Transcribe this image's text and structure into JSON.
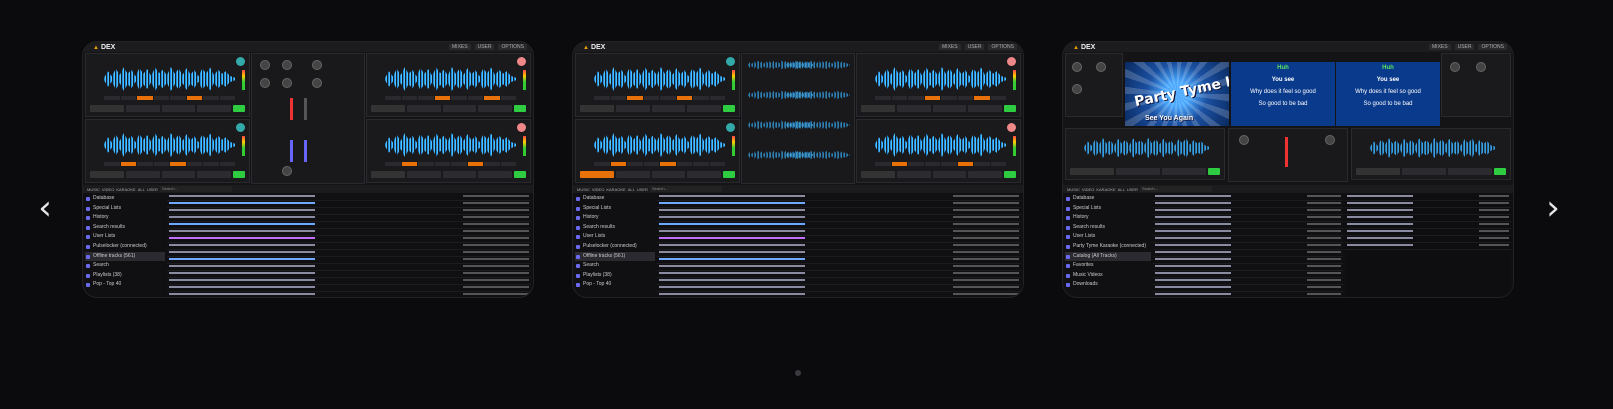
{
  "nav": {
    "prev_icon": "‹",
    "next_icon": "›"
  },
  "app": {
    "logo": "DEX"
  },
  "topbar": [
    "MIXES",
    "USER",
    "OPTIONS"
  ],
  "browser_tools": [
    "MUSIC",
    "VIDEO",
    "KARAOKE",
    "ALL",
    "USER"
  ],
  "search_placeholder": "Search...",
  "slides": [
    {
      "tree": [
        "Database",
        "Special Lists",
        "History",
        "Search results",
        "User Lists",
        "Pulselocker (connected)",
        "Offline tracks (561)",
        "Search",
        "Playlists (38)",
        "Pop - Top 40"
      ],
      "selected": 6
    },
    {
      "tree": [
        "Database",
        "Special Lists",
        "History",
        "Search results",
        "User Lists",
        "Pulselocker (connected)",
        "Offline tracks (561)",
        "Search",
        "Playlists (38)",
        "Pop - Top 40"
      ],
      "selected": 6
    },
    {
      "tree": [
        "Database",
        "Special Lists",
        "History",
        "Search results",
        "User Lists",
        "Party Tyme Karaoke (connected)",
        "Catalog (All Tracks)",
        "Favorites",
        "Music Videos",
        "Downloads"
      ],
      "selected": 6
    }
  ],
  "karaoke": {
    "video_title": "Party Tyme Karaoke",
    "video_sub": "See You Again",
    "lyrics": [
      "Huh",
      "You see",
      "Why does it feel so good",
      "So good to be bad"
    ]
  },
  "colors": {
    "accent": "#e8a000",
    "wave": "#1e88e5",
    "play": "#2ecc40",
    "hotcue": "#e8710a"
  }
}
